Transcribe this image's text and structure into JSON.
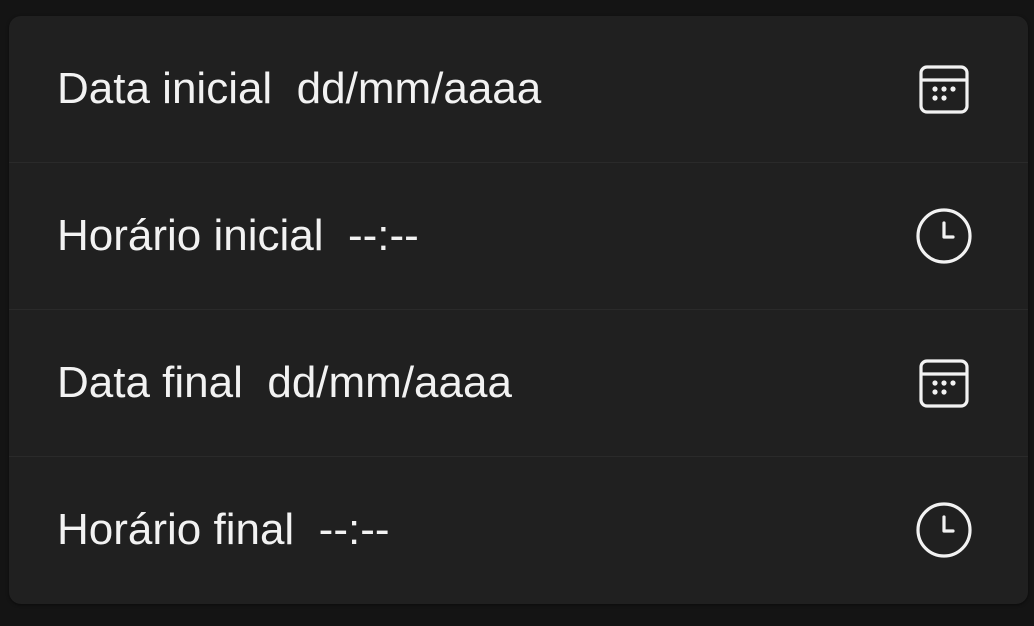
{
  "fields": [
    {
      "label": "Data inicial",
      "value": "dd/mm/aaaa",
      "icon": "calendar-icon"
    },
    {
      "label": "Horário inicial",
      "value": "--:--",
      "icon": "clock-icon"
    },
    {
      "label": "Data final",
      "value": "dd/mm/aaaa",
      "icon": "calendar-icon"
    },
    {
      "label": "Horário final",
      "value": "--:--",
      "icon": "clock-icon"
    }
  ],
  "colors": {
    "background": "#141414",
    "panel": "#202020",
    "text": "#f2f2f2",
    "divider": "#2a2a2a"
  }
}
